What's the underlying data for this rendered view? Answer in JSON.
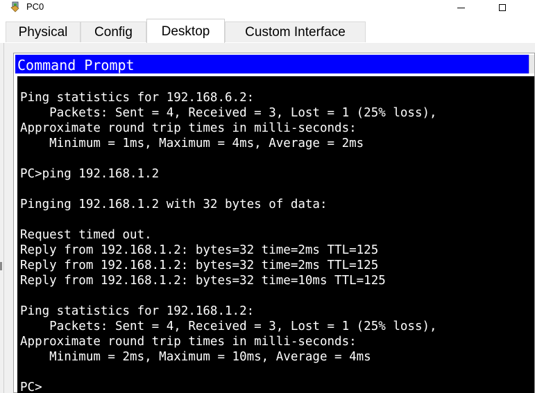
{
  "window": {
    "title": "PC0"
  },
  "tabs": [
    {
      "label": "Physical",
      "active": false
    },
    {
      "label": "Config",
      "active": false
    },
    {
      "label": "Desktop",
      "active": true
    },
    {
      "label": "Custom Interface",
      "active": false
    }
  ],
  "app": {
    "title": "Command Prompt"
  },
  "terminal": {
    "lines": [
      "Ping statistics for 192.168.6.2:",
      "    Packets: Sent = 4, Received = 3, Lost = 1 (25% loss),",
      "Approximate round trip times in milli-seconds:",
      "    Minimum = 1ms, Maximum = 4ms, Average = 2ms",
      "",
      "PC>ping 192.168.1.2",
      "",
      "Pinging 192.168.1.2 with 32 bytes of data:",
      "",
      "Request timed out.",
      "Reply from 192.168.1.2: bytes=32 time=2ms TTL=125",
      "Reply from 192.168.1.2: bytes=32 time=2ms TTL=125",
      "Reply from 192.168.1.2: bytes=32 time=10ms TTL=125",
      "",
      "Ping statistics for 192.168.1.2:",
      "    Packets: Sent = 4, Received = 3, Lost = 1 (25% loss),",
      "Approximate round trip times in milli-seconds:",
      "    Minimum = 2ms, Maximum = 10ms, Average = 4ms",
      "",
      "PC>"
    ]
  },
  "colors": {
    "app_titlebar": "#0000ff",
    "terminal_bg": "#000000",
    "terminal_text": "#ffffff"
  },
  "icons": {
    "app": "packet-tracer-pc-icon",
    "minimize": "minimize-icon",
    "maximize": "maximize-icon"
  }
}
